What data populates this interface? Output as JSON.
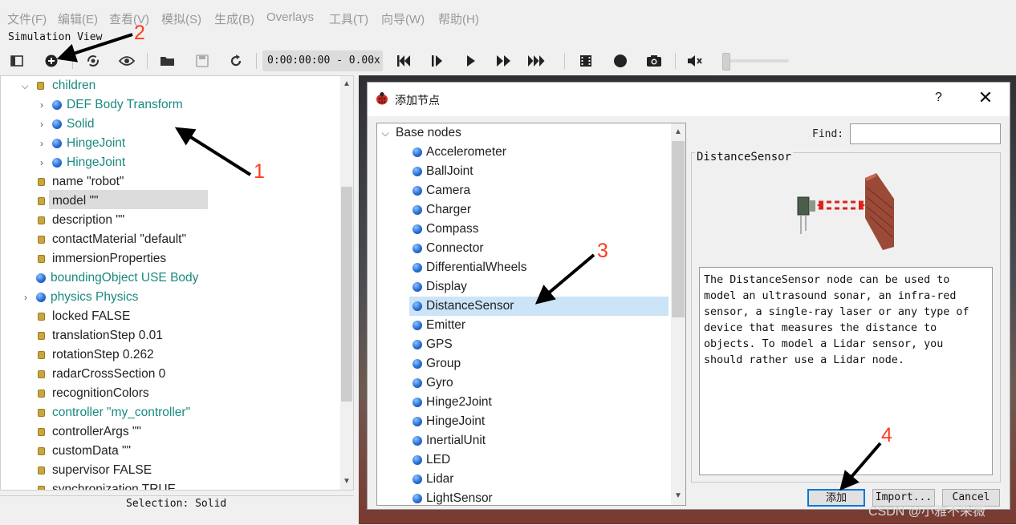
{
  "menu": {
    "items": [
      "文件(F)",
      "编辑(E)",
      "查看(V)",
      "模拟(S)",
      "生成(B)",
      "Overlays",
      "工具(T)",
      "向导(W)",
      "帮助(H)"
    ]
  },
  "simulation_view": {
    "label": "Simulation View"
  },
  "toolbar": {
    "time": "0:00:00:00 -  0.00x",
    "icons": [
      "toggle-panel-icon",
      "add-node-icon",
      "reset-view-icon",
      "visibility-icon",
      "open-world-icon",
      "save-world-icon",
      "reload-world-icon",
      "step-back-icon",
      "step-icon",
      "play-icon",
      "fast-forward-icon",
      "fastest-icon",
      "record-movie-icon",
      "record-dot-icon",
      "screenshot-icon",
      "mute-icon"
    ]
  },
  "scene_tree": {
    "rows": [
      "children",
      "DEF Body Transform",
      "Solid",
      "HingeJoint",
      "HingeJoint",
      "name \"robot\"",
      "model \"\"",
      "description \"\"",
      "contactMaterial \"default\"",
      "immersionProperties",
      "boundingObject USE Body",
      "physics Physics",
      "locked FALSE",
      "translationStep 0.01",
      "rotationStep 0.262",
      "radarCrossSection 0",
      "recognitionColors",
      "controller \"my_controller\"",
      "controllerArgs \"\"",
      "customData \"\"",
      "supervisor FALSE",
      "synchronization TRUE"
    ]
  },
  "selection_bar": {
    "text": "Selection: Solid"
  },
  "dialog": {
    "title": "添加节点",
    "help": "?",
    "close": "✕",
    "list_root": "Base nodes",
    "nodes": [
      "Accelerometer",
      "BallJoint",
      "Camera",
      "Charger",
      "Compass",
      "Connector",
      "DifferentialWheels",
      "Display",
      "DistanceSensor",
      "Emitter",
      "GPS",
      "Group",
      "Gyro",
      "Hinge2Joint",
      "HingeJoint",
      "InertialUnit",
      "LED",
      "Lidar",
      "LightSensor"
    ],
    "selected_node": "DistanceSensor",
    "find_label": "Find:",
    "find_value": "",
    "node_title": "DistanceSensor",
    "description": "The DistanceSensor node can be used to model an ultrasound sonar, an infra-red sensor, a single-ray laser or any type of device that measures the distance to objects. To model a Lidar sensor, you should rather use a Lidar node.",
    "buttons": {
      "add": "添加",
      "import": "Import...",
      "cancel": "Cancel"
    }
  },
  "annotations": {
    "n1": "1",
    "n2": "2",
    "n3": "3",
    "n4": "4"
  },
  "watermark": "CSDN @小雅不采薇",
  "colors": {
    "teal_text": "#1a8a80",
    "selection_bg": "#cce4f7",
    "annotation": "#ff3b1f"
  }
}
